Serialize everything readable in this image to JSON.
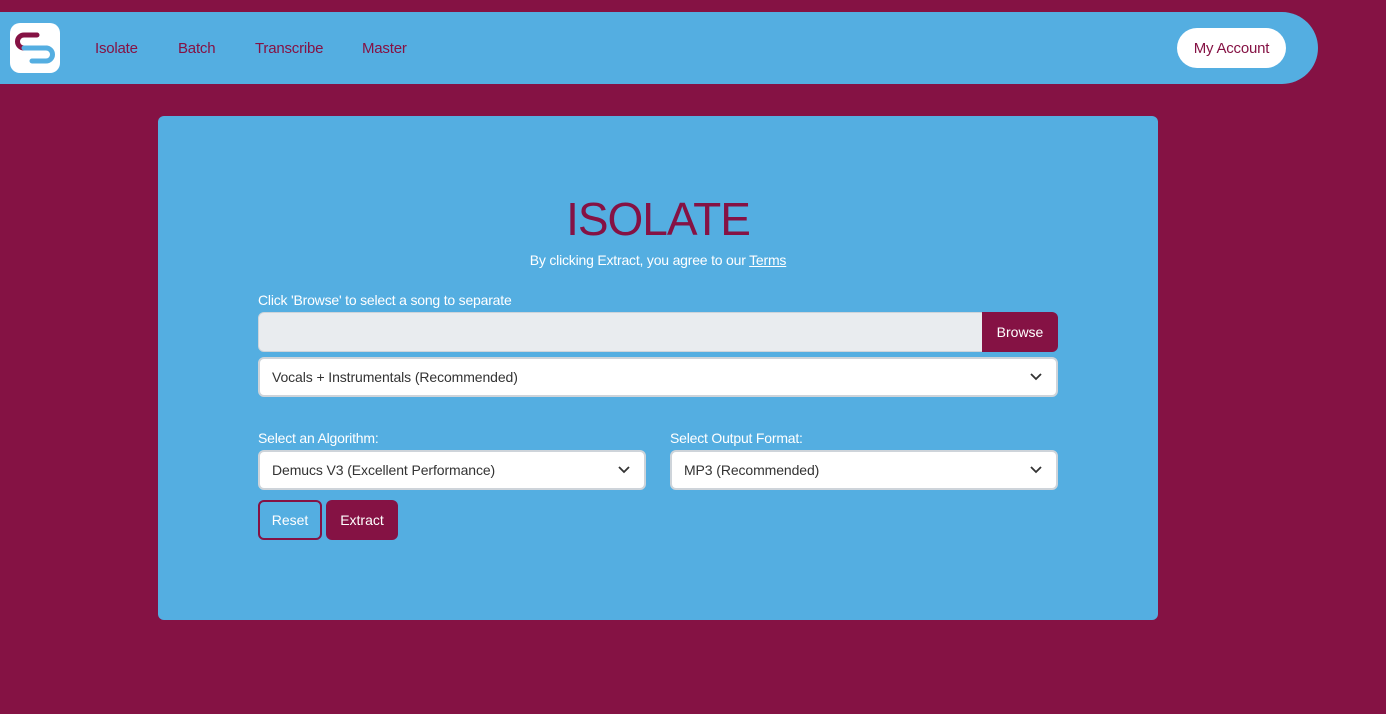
{
  "colors": {
    "brand": "#851244",
    "panel": "#54aee1",
    "input_bg": "#e9ecef",
    "white": "#ffffff"
  },
  "nav": {
    "logo_icon": "logo-icon",
    "links": [
      "Isolate",
      "Batch",
      "Transcribe",
      "Master"
    ],
    "account_label": "My Account"
  },
  "form": {
    "title": "ISOLATE",
    "terms_text": "By clicking Extract, you agree to our",
    "terms_link": "Terms",
    "file_label": "Click 'Browse' to select a song to separate",
    "file_value": "",
    "browse_label": "Browse",
    "separation_value": "Vocals + Instrumentals (Recommended)",
    "algorithm_label": "Select an Algorithm:",
    "algorithm_value": "Demucs V3 (Excellent Performance)",
    "format_label": "Select Output Format:",
    "format_value": "MP3 (Recommended)",
    "reset_label": "Reset",
    "extract_label": "Extract",
    "chevron_icon": "chevron-down-icon"
  }
}
